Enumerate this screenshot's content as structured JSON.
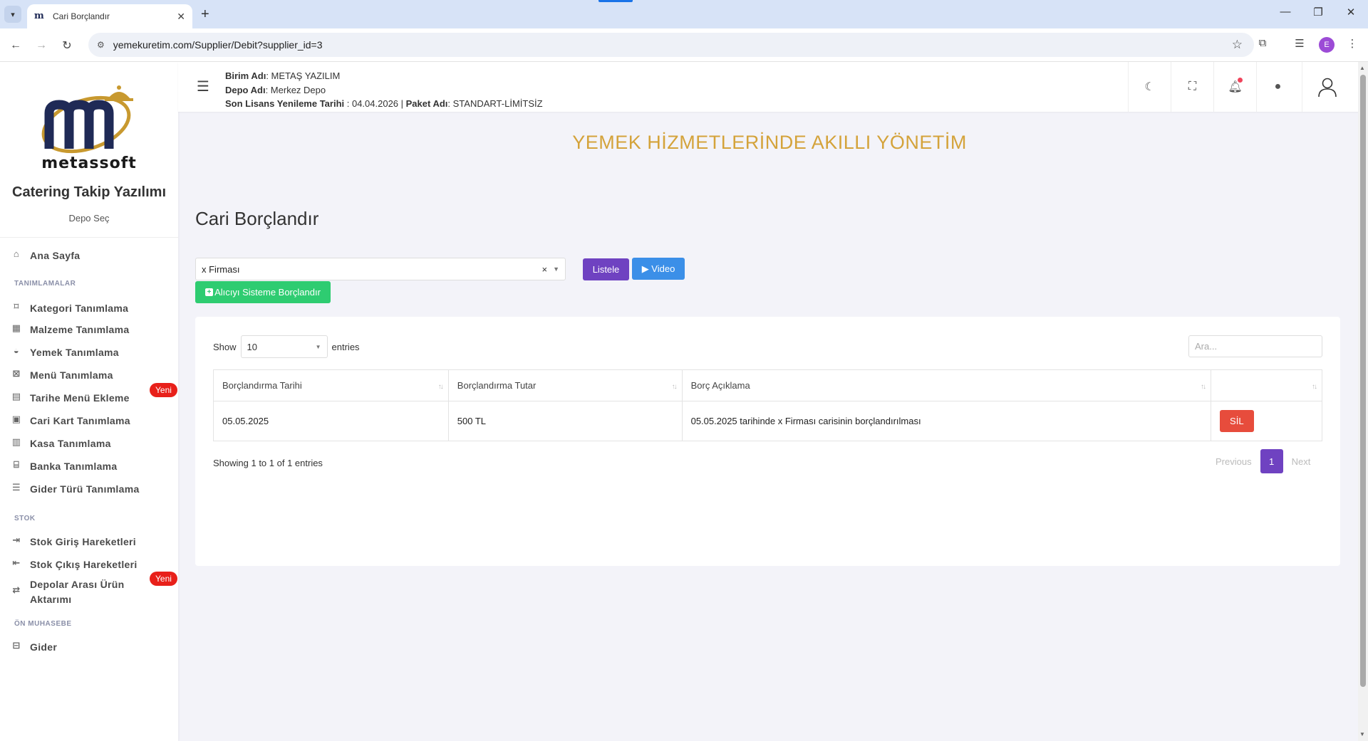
{
  "browser": {
    "tab_title": "Cari Borçlandır",
    "url": "yemekuretim.com/Supplier/Debit?supplier_id=3",
    "profile_initial": "E"
  },
  "sidebar": {
    "logo_text": "metassoft",
    "brand": "Catering Takip Yazılımı",
    "depo_sec": "Depo Seç",
    "home": "Ana Sayfa",
    "sections": {
      "tanimlamalar": "TANIMLAMALAR",
      "stok": "STOK",
      "on_muhasebe": "ÖN MUHASEBE"
    },
    "items": [
      {
        "label": "Kategori Tanımlama",
        "icon": "tag-icon"
      },
      {
        "label": "Malzeme Tanımlama",
        "icon": "box-icon"
      },
      {
        "label": "Yemek Tanımlama",
        "icon": "bowl-icon"
      },
      {
        "label": "Menü Tanımlama",
        "icon": "menu-icon"
      },
      {
        "label": "Tarihe Menü Ekleme",
        "icon": "calendar-icon"
      },
      {
        "label": "Cari Kart Tanımlama",
        "icon": "card-icon"
      },
      {
        "label": "Kasa Tanımlama",
        "icon": "register-icon"
      },
      {
        "label": "Banka Tanımlama",
        "icon": "bank-icon"
      },
      {
        "label": "Gider Türü Tanımlama",
        "icon": "list-icon"
      }
    ],
    "stok_items": [
      {
        "label": "Stok Giriş Hareketleri",
        "icon": "login-icon"
      },
      {
        "label": "Stok Çıkış Hareketleri",
        "icon": "logout-icon"
      },
      {
        "label_line1": "Depolar Arası Ürün",
        "label_line2": "Aktarımı",
        "icon": "transfer-icon"
      }
    ],
    "muhasebe_items": [
      {
        "label": "Gider",
        "icon": "expense-icon"
      }
    ],
    "badge_new": "Yeni"
  },
  "topbar": {
    "birim_label": "Birim Adı",
    "birim_value": ": METAŞ YAZILIM",
    "depo_label": "Depo Adı",
    "depo_value": ": Merkez Depo",
    "lisans_label": "Son Lisans Yenileme Tarihi",
    "lisans_value": " : 04.04.2026 | ",
    "paket_label": "Paket Adı",
    "paket_value": ": STANDART-LİMİTSİZ"
  },
  "slogan": "YEMEK HİZMETLERİNDE AKILLI YÖNETİM",
  "page_title": "Cari Borçlandır",
  "filter": {
    "selected_supplier": "x Firması",
    "clear": "×",
    "listele": "Listele",
    "video": "▶ Video",
    "alici": "Alıcıyı Sisteme Borçlandır"
  },
  "table": {
    "show_label": "Show",
    "entries_value": "10",
    "entries_label": "entries",
    "search_placeholder": "Ara...",
    "columns": [
      "Borçlandırma Tarihi",
      "Borçlandırma Tutar",
      "Borç Açıklama",
      ""
    ],
    "rows": [
      {
        "tarih": "05.05.2025",
        "tutar": "500 TL",
        "aciklama": "05.05.2025 tarihinde x Firması carisinin borçlandırılması",
        "action": "SİL"
      }
    ],
    "showing": "Showing 1 to 1 of 1 entries",
    "pagination": {
      "previous": "Previous",
      "current": "1",
      "next": "Next"
    }
  },
  "colors": {
    "accent_purple": "#6f42c1",
    "video_blue": "#3b8fe8",
    "success_green": "#2ecc71",
    "danger_red": "#e74c3c",
    "slogan_gold": "#d4a33b"
  }
}
